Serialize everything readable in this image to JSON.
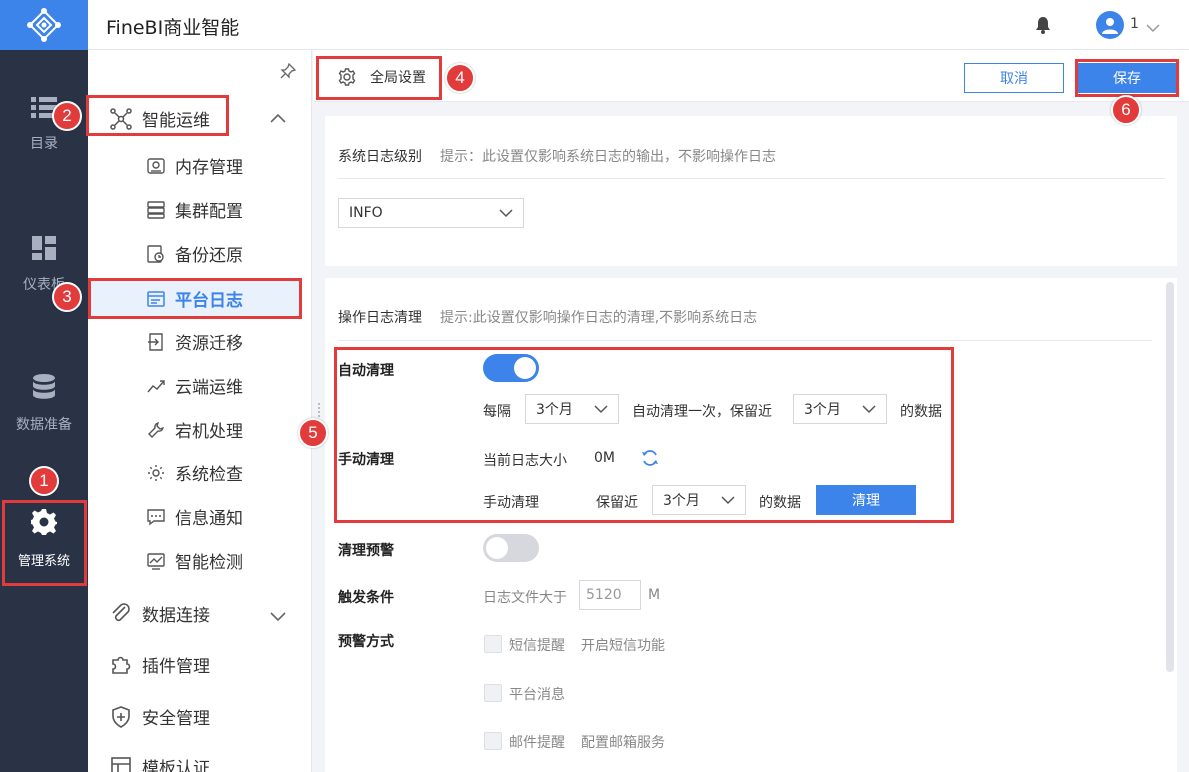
{
  "app": {
    "title": "FineBI商业智能",
    "user_name": "1"
  },
  "rail": [
    {
      "label": "目录",
      "icon": "list-icon"
    },
    {
      "label": "仪表板",
      "icon": "dashboard-icon"
    },
    {
      "label": "数据准备",
      "icon": "database-icon"
    },
    {
      "label": "管理系统",
      "icon": "gear-icon",
      "active": true
    }
  ],
  "subnav": {
    "group_ops": "智能运维",
    "items": [
      "内存管理",
      "集群配置",
      "备份还原",
      "平台日志",
      "资源迁移",
      "云端运维",
      "宕机处理",
      "系统检查",
      "信息通知",
      "智能检测"
    ],
    "group_data": "数据连接",
    "group_plugin": "插件管理",
    "group_security": "安全管理",
    "group_template": "模板认证"
  },
  "header": {
    "title": "全局设置",
    "cancel": "取消",
    "save": "保存"
  },
  "syslog": {
    "label": "系统日志级别",
    "hint": "提示：此设置仅影响系统日志的输出，不影响操作日志",
    "level": "INFO"
  },
  "oplog": {
    "label": "操作日志清理",
    "hint": "提示:此设置仅影响操作日志的清理,不影响系统日志",
    "auto_label": "自动清理",
    "every": "每隔",
    "every_value": "3个月",
    "auto_middle": "自动清理一次，保留近",
    "keep_value": "3个月",
    "data_suffix": "的数据",
    "manual_label": "手动清理",
    "current_size_label": "当前日志大小",
    "current_size": "0M",
    "manual_sub_label": "手动清理",
    "keep_label": "保留近",
    "manual_keep_value": "3个月",
    "manual_suffix": "的数据",
    "clear_button": "清理",
    "warn_label": "清理预警",
    "trigger_label": "触发条件",
    "trigger_text": "日志文件大于",
    "trigger_value": "5120",
    "trigger_unit": "M",
    "warn_method_label": "预警方式",
    "sms": "短信提醒",
    "sms_link": "开启短信功能",
    "platform_msg": "平台消息",
    "mail": "邮件提醒",
    "mail_link": "配置邮箱服务"
  },
  "annotations": [
    "1",
    "2",
    "3",
    "4",
    "5",
    "6"
  ],
  "colors": {
    "accent": "#3d84ea",
    "rail": "#2a3346",
    "annotation": "#e23b3b"
  }
}
